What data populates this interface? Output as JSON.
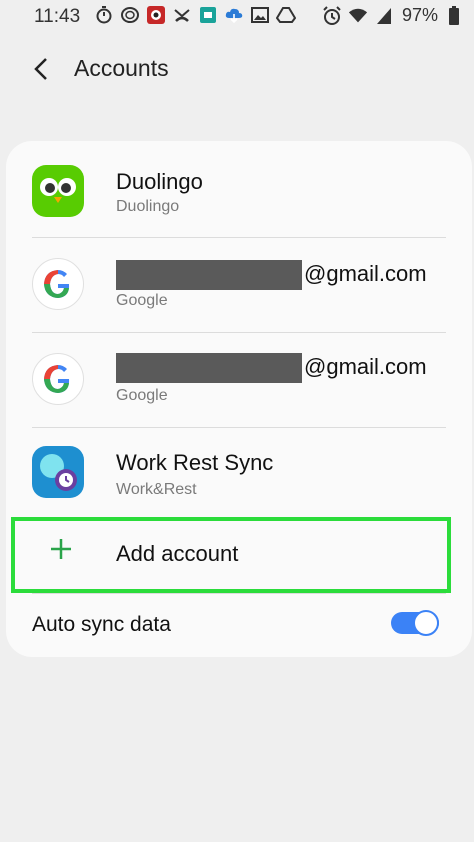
{
  "status_bar": {
    "time": "11:43",
    "battery": "97%"
  },
  "header": {
    "title": "Accounts"
  },
  "accounts": [
    {
      "name": "Duolingo",
      "subtitle": "Duolingo",
      "icon": "duolingo-owl-icon"
    },
    {
      "name": "@gmail.com",
      "subtitle": "Google",
      "icon": "google-g-icon"
    },
    {
      "name": "@gmail.com",
      "subtitle": "Google",
      "icon": "google-g-icon"
    },
    {
      "name": "Work Rest Sync",
      "subtitle": "Work&Rest",
      "icon": "work-rest-sync-icon"
    }
  ],
  "add_account": {
    "label": "Add account"
  },
  "auto_sync": {
    "label": "Auto sync data",
    "enabled": true
  },
  "colors": {
    "accent_toggle": "#3b82f6",
    "highlight_border": "#2bdc3b",
    "plus_green": "#2aa44a"
  }
}
